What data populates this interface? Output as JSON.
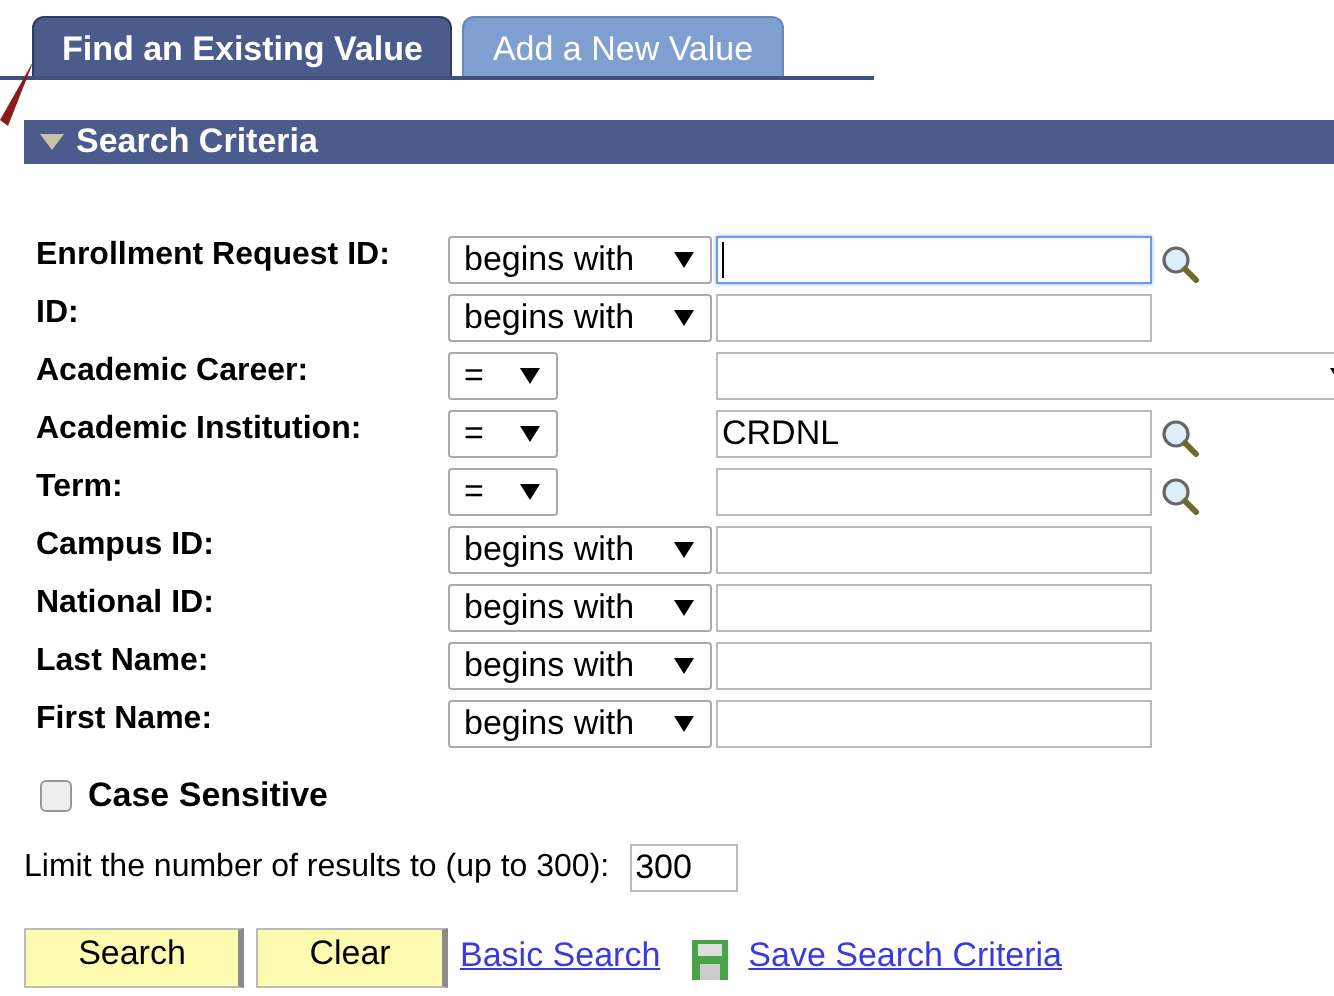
{
  "tabs": [
    {
      "label": "Find an Existing Value",
      "selected": true
    },
    {
      "label": "Add a New Value",
      "selected": false
    }
  ],
  "section": {
    "title": "Search Criteria",
    "expanded": true
  },
  "criteria": [
    {
      "label": "Enrollment Request ID:",
      "operator": "begins with",
      "kind": "text",
      "focused": true,
      "lookup": true
    },
    {
      "label": "ID:",
      "operator": "begins with",
      "kind": "text",
      "focused": false,
      "lookup": false
    },
    {
      "label": "Academic Career:",
      "operator": "=",
      "kind": "select",
      "focused": false,
      "lookup": false
    },
    {
      "label": "Academic Institution:",
      "operator": "=",
      "kind": "text",
      "value": "CRDNL",
      "focused": false,
      "lookup": true
    },
    {
      "label": "Term:",
      "operator": "=",
      "kind": "text",
      "focused": false,
      "lookup": true
    },
    {
      "label": "Campus ID:",
      "operator": "begins with",
      "kind": "text",
      "focused": false,
      "lookup": false
    },
    {
      "label": "National ID:",
      "operator": "begins with",
      "kind": "text",
      "focused": false,
      "lookup": false
    },
    {
      "label": "Last Name:",
      "operator": "begins with",
      "kind": "text",
      "focused": false,
      "lookup": false
    },
    {
      "label": "First Name:",
      "operator": "begins with",
      "kind": "text",
      "focused": false,
      "lookup": false
    }
  ],
  "case_sensitive": {
    "label": "Case Sensitive",
    "checked": false
  },
  "limit": {
    "label": "Limit the number of results to (up to 300):",
    "value": "300"
  },
  "buttons": [
    "Search",
    "Clear"
  ],
  "links": [
    {
      "label": "Basic Search",
      "icon": false
    },
    {
      "label": "Save Search Criteria",
      "icon": true
    }
  ]
}
